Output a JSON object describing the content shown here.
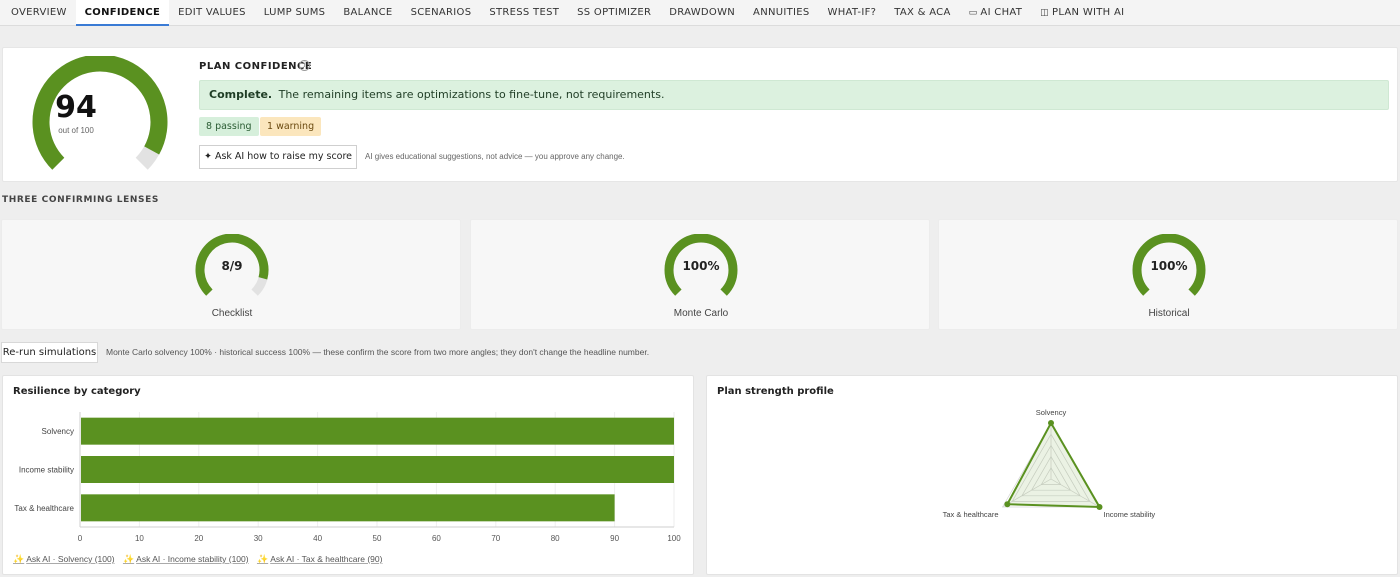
{
  "tabs": [
    {
      "label": "OVERVIEW",
      "icon": ""
    },
    {
      "label": "CONFIDENCE",
      "icon": "",
      "active": true
    },
    {
      "label": "EDIT VALUES",
      "icon": ""
    },
    {
      "label": "LUMP SUMS",
      "icon": ""
    },
    {
      "label": "BALANCE",
      "icon": ""
    },
    {
      "label": "SCENARIOS",
      "icon": ""
    },
    {
      "label": "STRESS TEST",
      "icon": ""
    },
    {
      "label": "SS OPTIMIZER",
      "icon": ""
    },
    {
      "label": "DRAWDOWN",
      "icon": ""
    },
    {
      "label": "ANNUITIES",
      "icon": ""
    },
    {
      "label": "WHAT-IF?",
      "icon": ""
    },
    {
      "label": "TAX & ACA",
      "icon": ""
    },
    {
      "label": "AI CHAT",
      "icon": "chat-bubble-icon"
    },
    {
      "label": "PLAN WITH AI",
      "icon": "book-icon"
    }
  ],
  "confidence": {
    "score": "94",
    "score_value": 94,
    "score_max": 100,
    "score_sub": "out of 100",
    "title": "PLAN CONFIDENCE",
    "info_icon": "info-icon",
    "banner_strong": "Complete.",
    "banner_text": "The remaining items are optimizations to fine-tune, not requirements.",
    "passing": "8 passing",
    "warning": "1 warning",
    "ask_button": "✦ Ask AI how to raise my score",
    "ai_note": "AI gives educational suggestions, not advice — you approve any change.",
    "gauge_color": "#5a9120",
    "gauge_track": "#e2e2e2"
  },
  "lenses": {
    "title": "THREE CONFIRMING LENSES",
    "items": [
      {
        "value": "8/9",
        "fraction": 0.889,
        "label": "Checklist"
      },
      {
        "value": "100%",
        "fraction": 1.0,
        "label": "Monte Carlo"
      },
      {
        "value": "100%",
        "fraction": 1.0,
        "label": "Historical"
      }
    ]
  },
  "rerun": {
    "button": "Re-run simulations",
    "note": "Monte Carlo solvency 100% · historical success 100% — these confirm the score from two more angles; they don't change the headline number."
  },
  "resilience": {
    "title": "Resilience by category",
    "ask_links": [
      "Ask AI · Solvency (100)",
      "Ask AI · Income stability (100)",
      "Ask AI · Tax & healthcare (90)"
    ]
  },
  "strength": {
    "title": "Plan strength profile"
  },
  "chart_data": [
    {
      "type": "bar",
      "orientation": "horizontal",
      "title": "Resilience by category",
      "categories": [
        "Solvency",
        "Income stability",
        "Tax & healthcare"
      ],
      "values": [
        100,
        100,
        90
      ],
      "xlim": [
        0,
        100
      ],
      "xticks": [
        0,
        10,
        20,
        30,
        40,
        50,
        60,
        70,
        80,
        90,
        100
      ],
      "color": "#5a9120",
      "grid": true
    },
    {
      "type": "radar",
      "title": "Plan strength profile",
      "categories": [
        "Solvency",
        "Income stability",
        "Tax & healthcare"
      ],
      "values": [
        100,
        100,
        90
      ],
      "max": 100,
      "color": "#5a9120"
    }
  ]
}
